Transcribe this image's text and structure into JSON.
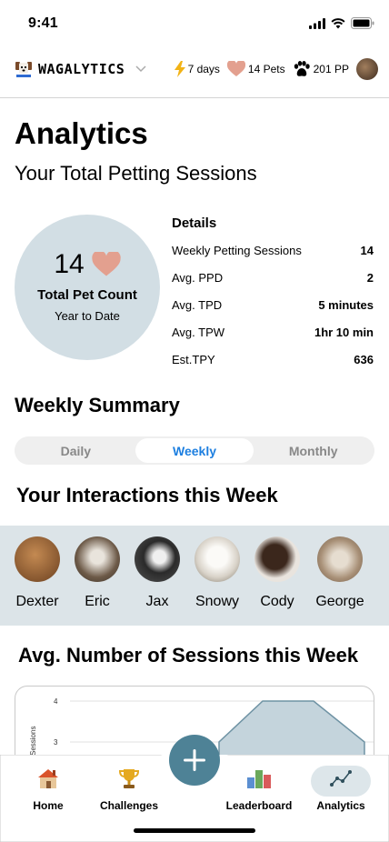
{
  "status_bar": {
    "time": "9:41"
  },
  "header": {
    "brand_name": "WAGALYTICS",
    "streak": "7 days",
    "pets": "14 Pets",
    "points": "201 PP"
  },
  "page": {
    "title": "Analytics",
    "subtitle": "Your Total Petting Sessions"
  },
  "summary": {
    "count": "14",
    "count_label": "Total Pet Count",
    "period": "Year to Date"
  },
  "details": {
    "title": "Details",
    "rows": [
      {
        "label": "Weekly Petting Sessions",
        "value": "14"
      },
      {
        "label": "Avg. PPD",
        "value": "2"
      },
      {
        "label": "Avg. TPD",
        "value": "5 minutes"
      },
      {
        "label": "Avg. TPW",
        "value": "1hr 10 min"
      },
      {
        "label": "Est.TPY",
        "value": "636"
      }
    ]
  },
  "weekly_summary": {
    "title": "Weekly Summary",
    "tabs": [
      "Daily",
      "Weekly",
      "Monthly"
    ],
    "selected": "Weekly"
  },
  "interactions": {
    "title": "Your Interactions this Week",
    "pets": [
      {
        "name": "Dexter",
        "color": "#a06a3a"
      },
      {
        "name": "Eric",
        "color": "#8b7a66"
      },
      {
        "name": "Jax",
        "color": "#3a3a3a"
      },
      {
        "name": "Snowy",
        "color": "#d9d4cc"
      },
      {
        "name": "Cody",
        "color": "#4a3326"
      },
      {
        "name": "George",
        "color": "#b9a58e"
      }
    ]
  },
  "chart_section": {
    "title": "Avg. Number of Sessions this Week"
  },
  "chart_data": {
    "type": "area",
    "ylabel": "Sessions",
    "y_ticks": [
      "4",
      "3"
    ],
    "ylim": [
      2,
      4
    ],
    "visible_series": [
      {
        "values": [
          3,
          4,
          4,
          3
        ]
      }
    ]
  },
  "tab_bar": {
    "tabs": [
      {
        "label": "Home"
      },
      {
        "label": "Challenges"
      },
      {
        "label": "Leaderboard"
      },
      {
        "label": "Analytics"
      }
    ],
    "active": "Analytics"
  },
  "colors": {
    "accent_blue": "#1d7fe0",
    "circle_bg": "#d2dee4",
    "band_bg": "#dce4e8",
    "fab": "#4e8296",
    "heart": "#e3a08f"
  }
}
